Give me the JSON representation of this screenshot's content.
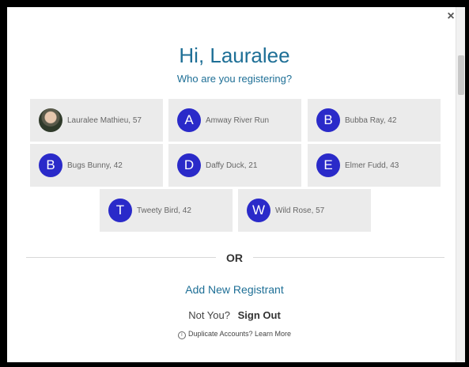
{
  "close_label": "×",
  "greeting": "Hi, Lauralee",
  "subtitle": "Who are you registering?",
  "registrants": [
    {
      "initial": "",
      "photo": true,
      "name": "Lauralee Mathieu, 57"
    },
    {
      "initial": "A",
      "name": "Amway River Run"
    },
    {
      "initial": "B",
      "name": "Bubba Ray, 42"
    },
    {
      "initial": "B",
      "name": "Bugs Bunny, 42"
    },
    {
      "initial": "D",
      "name": "Daffy Duck, 21"
    },
    {
      "initial": "E",
      "name": "Elmer Fudd, 43"
    },
    {
      "initial": "T",
      "name": "Tweety Bird, 42"
    },
    {
      "initial": "W",
      "name": "Wild Rose, 57"
    }
  ],
  "or_label": "OR",
  "add_new_label": "Add New Registrant",
  "not_you_label": "Not You?",
  "sign_out_label": "Sign Out",
  "info_icon": "i",
  "duplicate_label": "Duplicate Accounts? Learn More",
  "colors": {
    "accent": "#1e6f96",
    "avatar": "#2a2ac9",
    "card": "#ebebeb"
  }
}
